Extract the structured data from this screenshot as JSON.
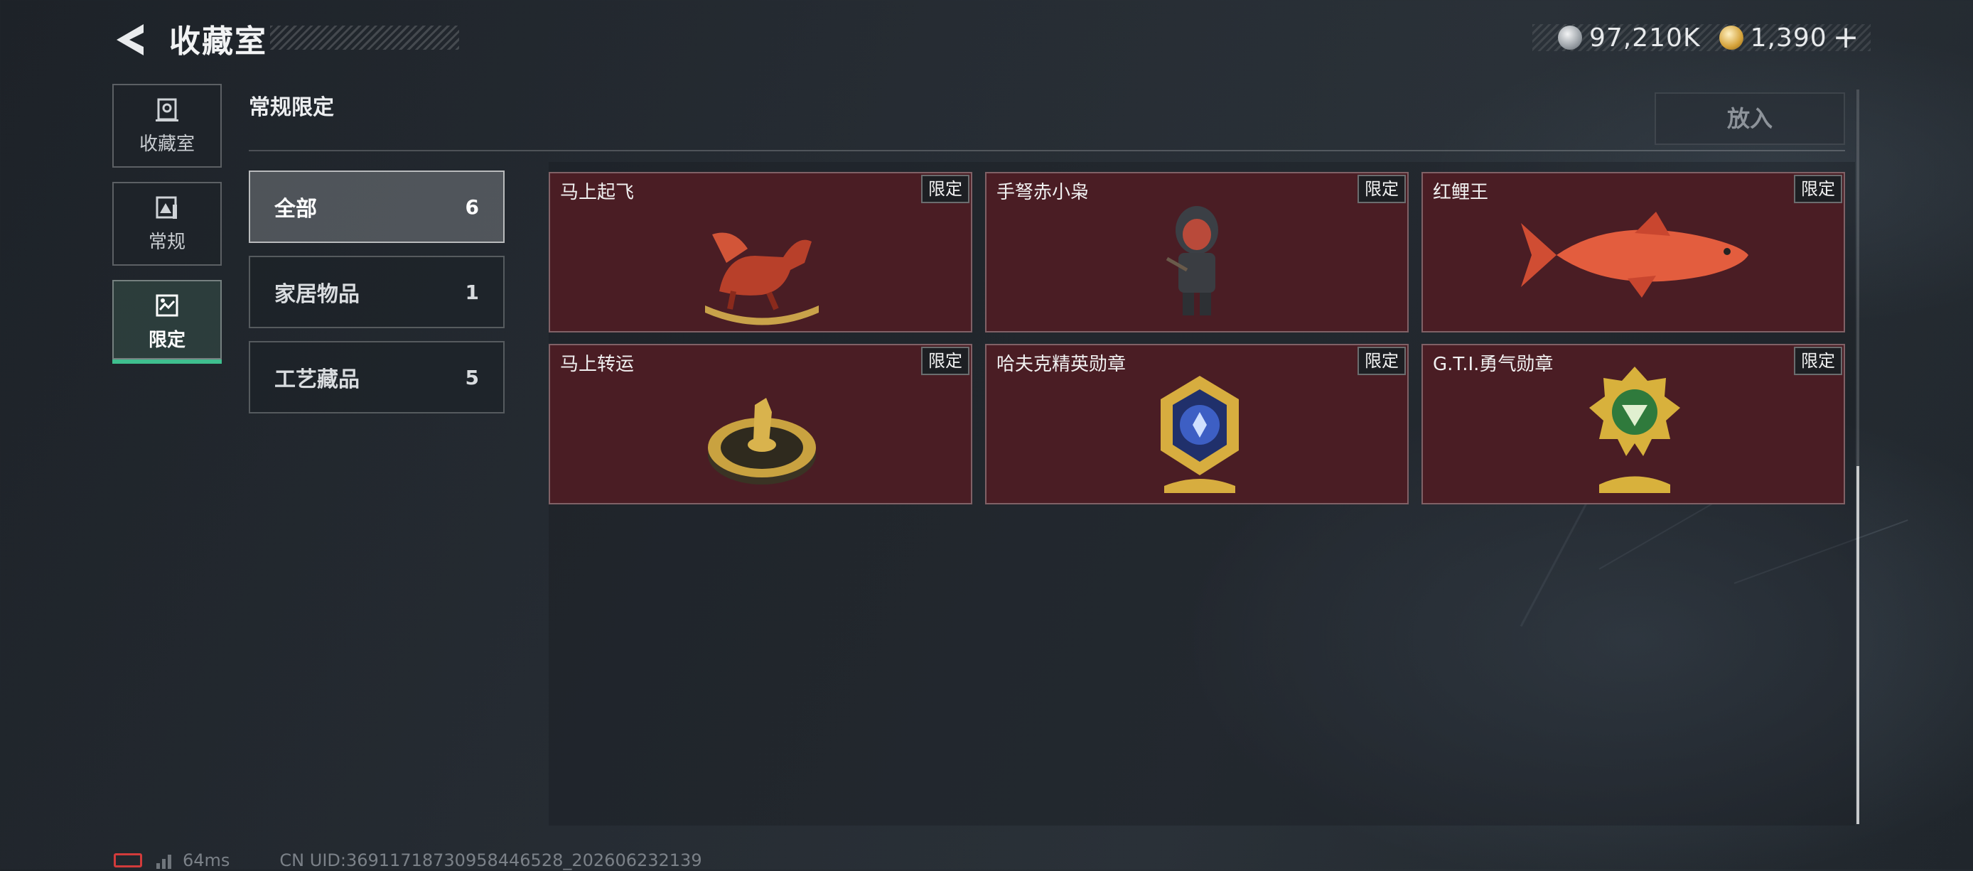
{
  "header": {
    "title": "收藏室",
    "currency": [
      {
        "icon": "silver-coin-icon",
        "value": "97,210K"
      },
      {
        "icon": "gold-coin-icon",
        "value": "1,390"
      }
    ],
    "add_label": "+"
  },
  "rail": [
    {
      "label": "收藏室",
      "icon": "collection-room-icon",
      "active": false
    },
    {
      "label": "常规",
      "icon": "regular-icon",
      "active": false
    },
    {
      "label": "限定",
      "icon": "limited-icon",
      "active": true
    }
  ],
  "section": {
    "title": "常规限定",
    "place_button": "放入"
  },
  "filters": [
    {
      "label": "全部",
      "count": "6",
      "active": true
    },
    {
      "label": "家居物品",
      "count": "1",
      "active": false
    },
    {
      "label": "工艺藏品",
      "count": "5",
      "active": false
    }
  ],
  "items": [
    {
      "name": "马上起飞",
      "tag": "限定",
      "art": "horse-rocker-figure"
    },
    {
      "name": "手弩赤小枭",
      "tag": "限定",
      "art": "hooded-crossbow-figure"
    },
    {
      "name": "红鲤王",
      "tag": "限定",
      "art": "red-carp"
    },
    {
      "name": "马上转运",
      "tag": "限定",
      "art": "golden-horse-turntable"
    },
    {
      "name": "哈夫克精英勋章",
      "tag": "限定",
      "art": "blue-gold-medal"
    },
    {
      "name": "G.T.I.勇气勋章",
      "tag": "限定",
      "art": "green-gold-medal"
    }
  ],
  "footer": {
    "latency": "64ms",
    "uid": "CN UID:369117187309584465​28_202606232139"
  },
  "colors": {
    "accent": "#3fbf8f",
    "card_bg": "#4a1d24",
    "battery_low": "#d23b3b"
  }
}
